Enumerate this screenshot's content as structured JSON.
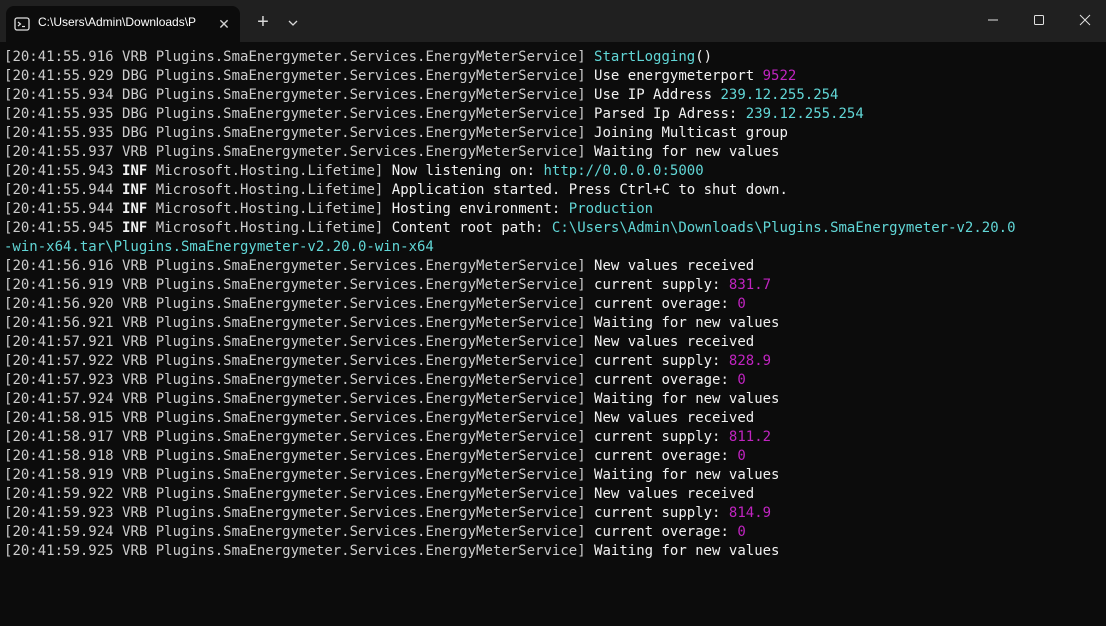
{
  "window": {
    "tab_title": "C:\\Users\\Admin\\Downloads\\P",
    "close_tab_glyph": "✕",
    "new_tab_glyph": "+",
    "tab_icon": "terminal-icon",
    "colors": {
      "titlebar": "#202020",
      "background": "#0c0c0c",
      "text": "#cccccc",
      "bright": "#f2f2f2",
      "cyan": "#61d6d6",
      "magenta": "#c024c0"
    }
  },
  "log_lines": [
    [
      "[",
      "20:41:55.916",
      " VRB ",
      "Plugins.SmaEnergymeter.Services.EnergyMeterService",
      "] ",
      [
        "c",
        "StartLogging"
      ],
      [
        "m",
        "()"
      ]
    ],
    [
      "[",
      "20:41:55.929",
      " DBG ",
      "Plugins.SmaEnergymeter.Services.EnergyMeterService",
      "] ",
      [
        "m",
        "Use energymeterport "
      ],
      [
        "g",
        "9522"
      ]
    ],
    [
      "[",
      "20:41:55.934",
      " DBG ",
      "Plugins.SmaEnergymeter.Services.EnergyMeterService",
      "] ",
      [
        "m",
        "Use IP Address "
      ],
      [
        "c",
        "239.12.255.254"
      ]
    ],
    [
      "[",
      "20:41:55.935",
      " DBG ",
      "Plugins.SmaEnergymeter.Services.EnergyMeterService",
      "] ",
      [
        "m",
        "Parsed Ip Adress: "
      ],
      [
        "c",
        "239.12.255.254"
      ]
    ],
    [
      "[",
      "20:41:55.935",
      " DBG ",
      "Plugins.SmaEnergymeter.Services.EnergyMeterService",
      "] ",
      [
        "m",
        "Joining Multicast group"
      ]
    ],
    [
      "[",
      "20:41:55.937",
      " VRB ",
      "Plugins.SmaEnergymeter.Services.EnergyMeterService",
      "] ",
      [
        "m",
        "Waiting for new values"
      ]
    ],
    [
      "[",
      "20:41:55.943",
      " INF ",
      "Microsoft.Hosting.Lifetime",
      "] ",
      [
        "m",
        "Now listening on: "
      ],
      [
        "c",
        "http://0.0.0.0:5000"
      ]
    ],
    [
      "[",
      "20:41:55.944",
      " INF ",
      "Microsoft.Hosting.Lifetime",
      "] ",
      [
        "m",
        "Application started. Press Ctrl+C to shut down."
      ]
    ],
    [
      "[",
      "20:41:55.944",
      " INF ",
      "Microsoft.Hosting.Lifetime",
      "] ",
      [
        "m",
        "Hosting environment: "
      ],
      [
        "c",
        "Production"
      ]
    ],
    [
      "[",
      "20:41:55.945",
      " INF ",
      "Microsoft.Hosting.Lifetime",
      "] ",
      [
        "m",
        "Content root path: "
      ],
      [
        "c",
        "C:\\Users\\Admin\\Downloads\\Plugins.SmaEnergymeter-v2.20.0"
      ]
    ],
    [
      "",
      "",
      "",
      "",
      "",
      [
        "c",
        "-win-x64.tar\\Plugins.SmaEnergymeter-v2.20.0-win-x64"
      ]
    ],
    [
      "[",
      "20:41:56.916",
      " VRB ",
      "Plugins.SmaEnergymeter.Services.EnergyMeterService",
      "] ",
      [
        "m",
        "New values received"
      ]
    ],
    [
      "[",
      "20:41:56.919",
      " VRB ",
      "Plugins.SmaEnergymeter.Services.EnergyMeterService",
      "] ",
      [
        "m",
        "current supply: "
      ],
      [
        "g",
        "831.7"
      ]
    ],
    [
      "[",
      "20:41:56.920",
      " VRB ",
      "Plugins.SmaEnergymeter.Services.EnergyMeterService",
      "] ",
      [
        "m",
        "current overage: "
      ],
      [
        "g",
        "0"
      ]
    ],
    [
      "[",
      "20:41:56.921",
      " VRB ",
      "Plugins.SmaEnergymeter.Services.EnergyMeterService",
      "] ",
      [
        "m",
        "Waiting for new values"
      ]
    ],
    [
      "[",
      "20:41:57.921",
      " VRB ",
      "Plugins.SmaEnergymeter.Services.EnergyMeterService",
      "] ",
      [
        "m",
        "New values received"
      ]
    ],
    [
      "[",
      "20:41:57.922",
      " VRB ",
      "Plugins.SmaEnergymeter.Services.EnergyMeterService",
      "] ",
      [
        "m",
        "current supply: "
      ],
      [
        "g",
        "828.9"
      ]
    ],
    [
      "[",
      "20:41:57.923",
      " VRB ",
      "Plugins.SmaEnergymeter.Services.EnergyMeterService",
      "] ",
      [
        "m",
        "current overage: "
      ],
      [
        "g",
        "0"
      ]
    ],
    [
      "[",
      "20:41:57.924",
      " VRB ",
      "Plugins.SmaEnergymeter.Services.EnergyMeterService",
      "] ",
      [
        "m",
        "Waiting for new values"
      ]
    ],
    [
      "[",
      "20:41:58.915",
      " VRB ",
      "Plugins.SmaEnergymeter.Services.EnergyMeterService",
      "] ",
      [
        "m",
        "New values received"
      ]
    ],
    [
      "[",
      "20:41:58.917",
      " VRB ",
      "Plugins.SmaEnergymeter.Services.EnergyMeterService",
      "] ",
      [
        "m",
        "current supply: "
      ],
      [
        "g",
        "811.2"
      ]
    ],
    [
      "[",
      "20:41:58.918",
      " VRB ",
      "Plugins.SmaEnergymeter.Services.EnergyMeterService",
      "] ",
      [
        "m",
        "current overage: "
      ],
      [
        "g",
        "0"
      ]
    ],
    [
      "[",
      "20:41:58.919",
      " VRB ",
      "Plugins.SmaEnergymeter.Services.EnergyMeterService",
      "] ",
      [
        "m",
        "Waiting for new values"
      ]
    ],
    [
      "[",
      "20:41:59.922",
      " VRB ",
      "Plugins.SmaEnergymeter.Services.EnergyMeterService",
      "] ",
      [
        "m",
        "New values received"
      ]
    ],
    [
      "[",
      "20:41:59.923",
      " VRB ",
      "Plugins.SmaEnergymeter.Services.EnergyMeterService",
      "] ",
      [
        "m",
        "current supply: "
      ],
      [
        "g",
        "814.9"
      ]
    ],
    [
      "[",
      "20:41:59.924",
      " VRB ",
      "Plugins.SmaEnergymeter.Services.EnergyMeterService",
      "] ",
      [
        "m",
        "current overage: "
      ],
      [
        "g",
        "0"
      ]
    ],
    [
      "[",
      "20:41:59.925",
      " VRB ",
      "Plugins.SmaEnergymeter.Services.EnergyMeterService",
      "] ",
      [
        "m",
        "Waiting for new values"
      ]
    ]
  ]
}
